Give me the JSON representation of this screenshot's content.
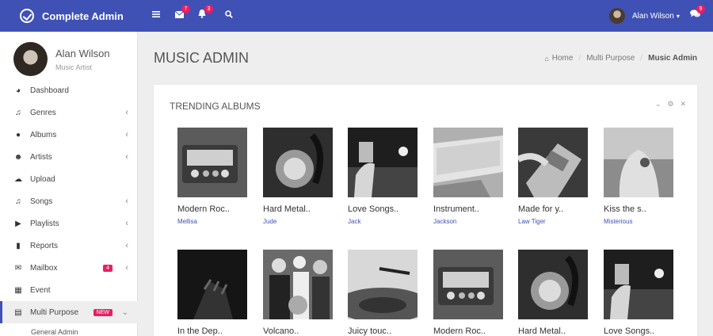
{
  "brand": {
    "name": "Complete Admin"
  },
  "topbar": {
    "mail_badge": "7",
    "bell_badge": "3",
    "username": "Alan Wilson",
    "chat_badge": "9"
  },
  "profile": {
    "name": "Alan Wilson",
    "role": "Music Artist"
  },
  "sidebar": {
    "items": [
      {
        "label": "Dashboard",
        "icon": "dashboard-icon"
      },
      {
        "label": "Genres",
        "icon": "music-note-icon"
      },
      {
        "label": "Albums",
        "icon": "microphone-icon"
      },
      {
        "label": "Artists",
        "icon": "users-icon"
      },
      {
        "label": "Upload",
        "icon": "cloud-upload-icon"
      },
      {
        "label": "Songs",
        "icon": "music-note-icon"
      },
      {
        "label": "Playlists",
        "icon": "play-circle-icon"
      },
      {
        "label": "Reports",
        "icon": "bar-chart-icon"
      },
      {
        "label": "Mailbox",
        "icon": "envelope-icon",
        "badge": "4"
      },
      {
        "label": "Event",
        "icon": "calendar-icon"
      },
      {
        "label": "Multi Purpose",
        "icon": "briefcase-icon",
        "badge": "NEW"
      }
    ],
    "subitem": "General Admin"
  },
  "page": {
    "title": "MUSIC ADMIN"
  },
  "breadcrumb": {
    "home": "Home",
    "middle": "Multi Purpose",
    "current": "Music Admin"
  },
  "panel": {
    "title": "TRENDING ALBUMS"
  },
  "albums": [
    {
      "title": "Modern Roc..",
      "artist": "Mellisa"
    },
    {
      "title": "Hard Metal..",
      "artist": "Jude"
    },
    {
      "title": "Love Songs..",
      "artist": "Jack"
    },
    {
      "title": "Instrument..",
      "artist": "Jackson"
    },
    {
      "title": "Made for y..",
      "artist": "Law Tiger"
    },
    {
      "title": "Kiss the s..",
      "artist": "Misterious"
    },
    {
      "title": "In the Dep..",
      "artist": ""
    },
    {
      "title": "Volcano..",
      "artist": ""
    },
    {
      "title": "Juicy touc..",
      "artist": ""
    },
    {
      "title": "Modern Roc..",
      "artist": ""
    },
    {
      "title": "Hard Metal..",
      "artist": ""
    },
    {
      "title": "Love Songs..",
      "artist": ""
    }
  ],
  "colors": {
    "primary": "#3f51b5",
    "badge": "#e91e63"
  }
}
